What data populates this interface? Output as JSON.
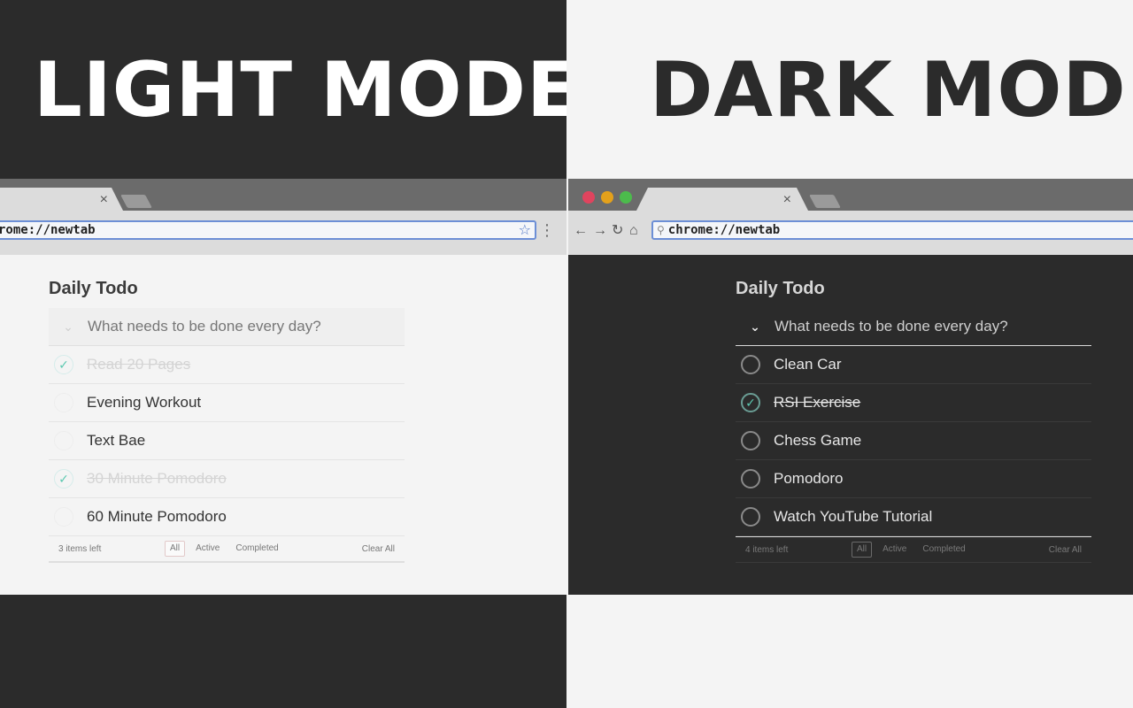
{
  "colors": {
    "dark_bg": "#2b2b2b",
    "light_bg": "#f4f4f4",
    "check_teal": "#5cc8b0",
    "omnibox_border": "#6c8fd6",
    "traffic_red": "#e0445e",
    "traffic_yellow": "#e4a11b",
    "traffic_green": "#4cbb4c"
  },
  "light": {
    "heading": "LIGHT MODE",
    "tab_close": "×",
    "url": "rome://newtab",
    "star_icon": "☆",
    "menu_icon": "⋮",
    "app_title": "Daily Todo",
    "toggle_icon": "⌄",
    "placeholder": "What needs to be done every day?",
    "todos": [
      {
        "text": "Read 20 Pages",
        "done": true
      },
      {
        "text": "Evening Workout",
        "done": false
      },
      {
        "text": "Text Bae",
        "done": false
      },
      {
        "text": "30 Minute Pomodoro",
        "done": true
      },
      {
        "text": "60 Minute Pomodoro",
        "done": false
      }
    ],
    "footer": {
      "count": "3 items left",
      "filter_all": "All",
      "filter_active": "Active",
      "filter_completed": "Completed",
      "clear": "Clear All"
    }
  },
  "dark": {
    "heading": "DARK MODE",
    "tab_close": "×",
    "back_icon": "←",
    "forward_icon": "→",
    "reload_icon": "↻",
    "home_icon": "⌂",
    "search_icon": "⚲",
    "url": "chrome://newtab",
    "app_title": "Daily Todo",
    "toggle_icon": "⌄",
    "placeholder": "What needs to be done every day?",
    "todos": [
      {
        "text": "Clean Car",
        "done": false
      },
      {
        "text": "RSI Exercise",
        "done": true
      },
      {
        "text": "Chess Game",
        "done": false
      },
      {
        "text": "Pomodoro",
        "done": false
      },
      {
        "text": "Watch YouTube Tutorial",
        "done": false
      }
    ],
    "footer": {
      "count": "4 items left",
      "filter_all": "All",
      "filter_active": "Active",
      "filter_completed": "Completed",
      "clear": "Clear All"
    }
  }
}
